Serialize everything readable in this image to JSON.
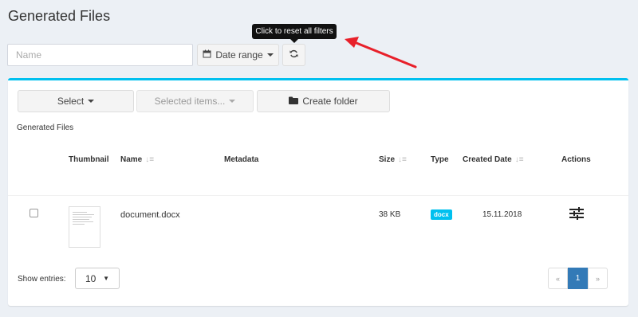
{
  "page_title": "Generated Files",
  "filters": {
    "name_placeholder": "Name",
    "name_value": "",
    "date_range_label": "Date range",
    "reset_tooltip": "Click to reset all filters"
  },
  "toolbar": {
    "select_label": "Select",
    "selected_items_label": "Selected items...",
    "create_folder_label": "Create folder"
  },
  "section_label": "Generated Files",
  "table": {
    "columns": {
      "thumbnail": "Thumbnail",
      "name": "Name",
      "metadata": "Metadata",
      "size": "Size",
      "type": "Type",
      "created_date": "Created Date",
      "actions": "Actions"
    },
    "rows": [
      {
        "name": "document.docx",
        "metadata": "",
        "size": "38 KB",
        "type": "docx",
        "created_date": "15.11.2018"
      }
    ]
  },
  "footer": {
    "show_entries_label": "Show entries:",
    "entries_value": "10",
    "pagination": {
      "prev": "«",
      "current": "1",
      "next": "»"
    }
  },
  "colors": {
    "accent": "#00c0ef",
    "primary": "#337ab7",
    "arrow": "#e8202a"
  },
  "icons": {
    "date": "calendar-icon",
    "reset": "refresh-icon",
    "folder": "folder-icon",
    "actions": "sliders-icon",
    "sort": "sort-icon"
  }
}
